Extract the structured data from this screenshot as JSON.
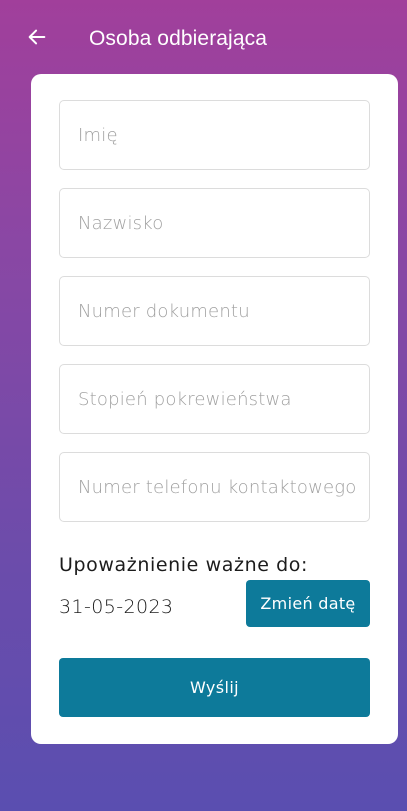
{
  "header": {
    "title": "Osoba odbierająca",
    "back_icon": "arrow-left-icon"
  },
  "form": {
    "fields": [
      {
        "placeholder": "Imię",
        "value": ""
      },
      {
        "placeholder": "Nazwisko",
        "value": ""
      },
      {
        "placeholder": "Numer dokumentu",
        "value": ""
      },
      {
        "placeholder": "Stopień pokrewieństwa",
        "value": ""
      },
      {
        "placeholder": "Numer telefonu kontaktowego",
        "value": ""
      }
    ],
    "valid_until_label": "Upoważnienie ważne do:",
    "valid_until_date": "31-05-2023",
    "change_date_label": "Zmień datę",
    "submit_label": "Wyślij"
  },
  "colors": {
    "gradient_top": "#a13f9b",
    "gradient_bottom": "#5a4eb0",
    "button": "#0d7a9a",
    "card": "#ffffff"
  }
}
